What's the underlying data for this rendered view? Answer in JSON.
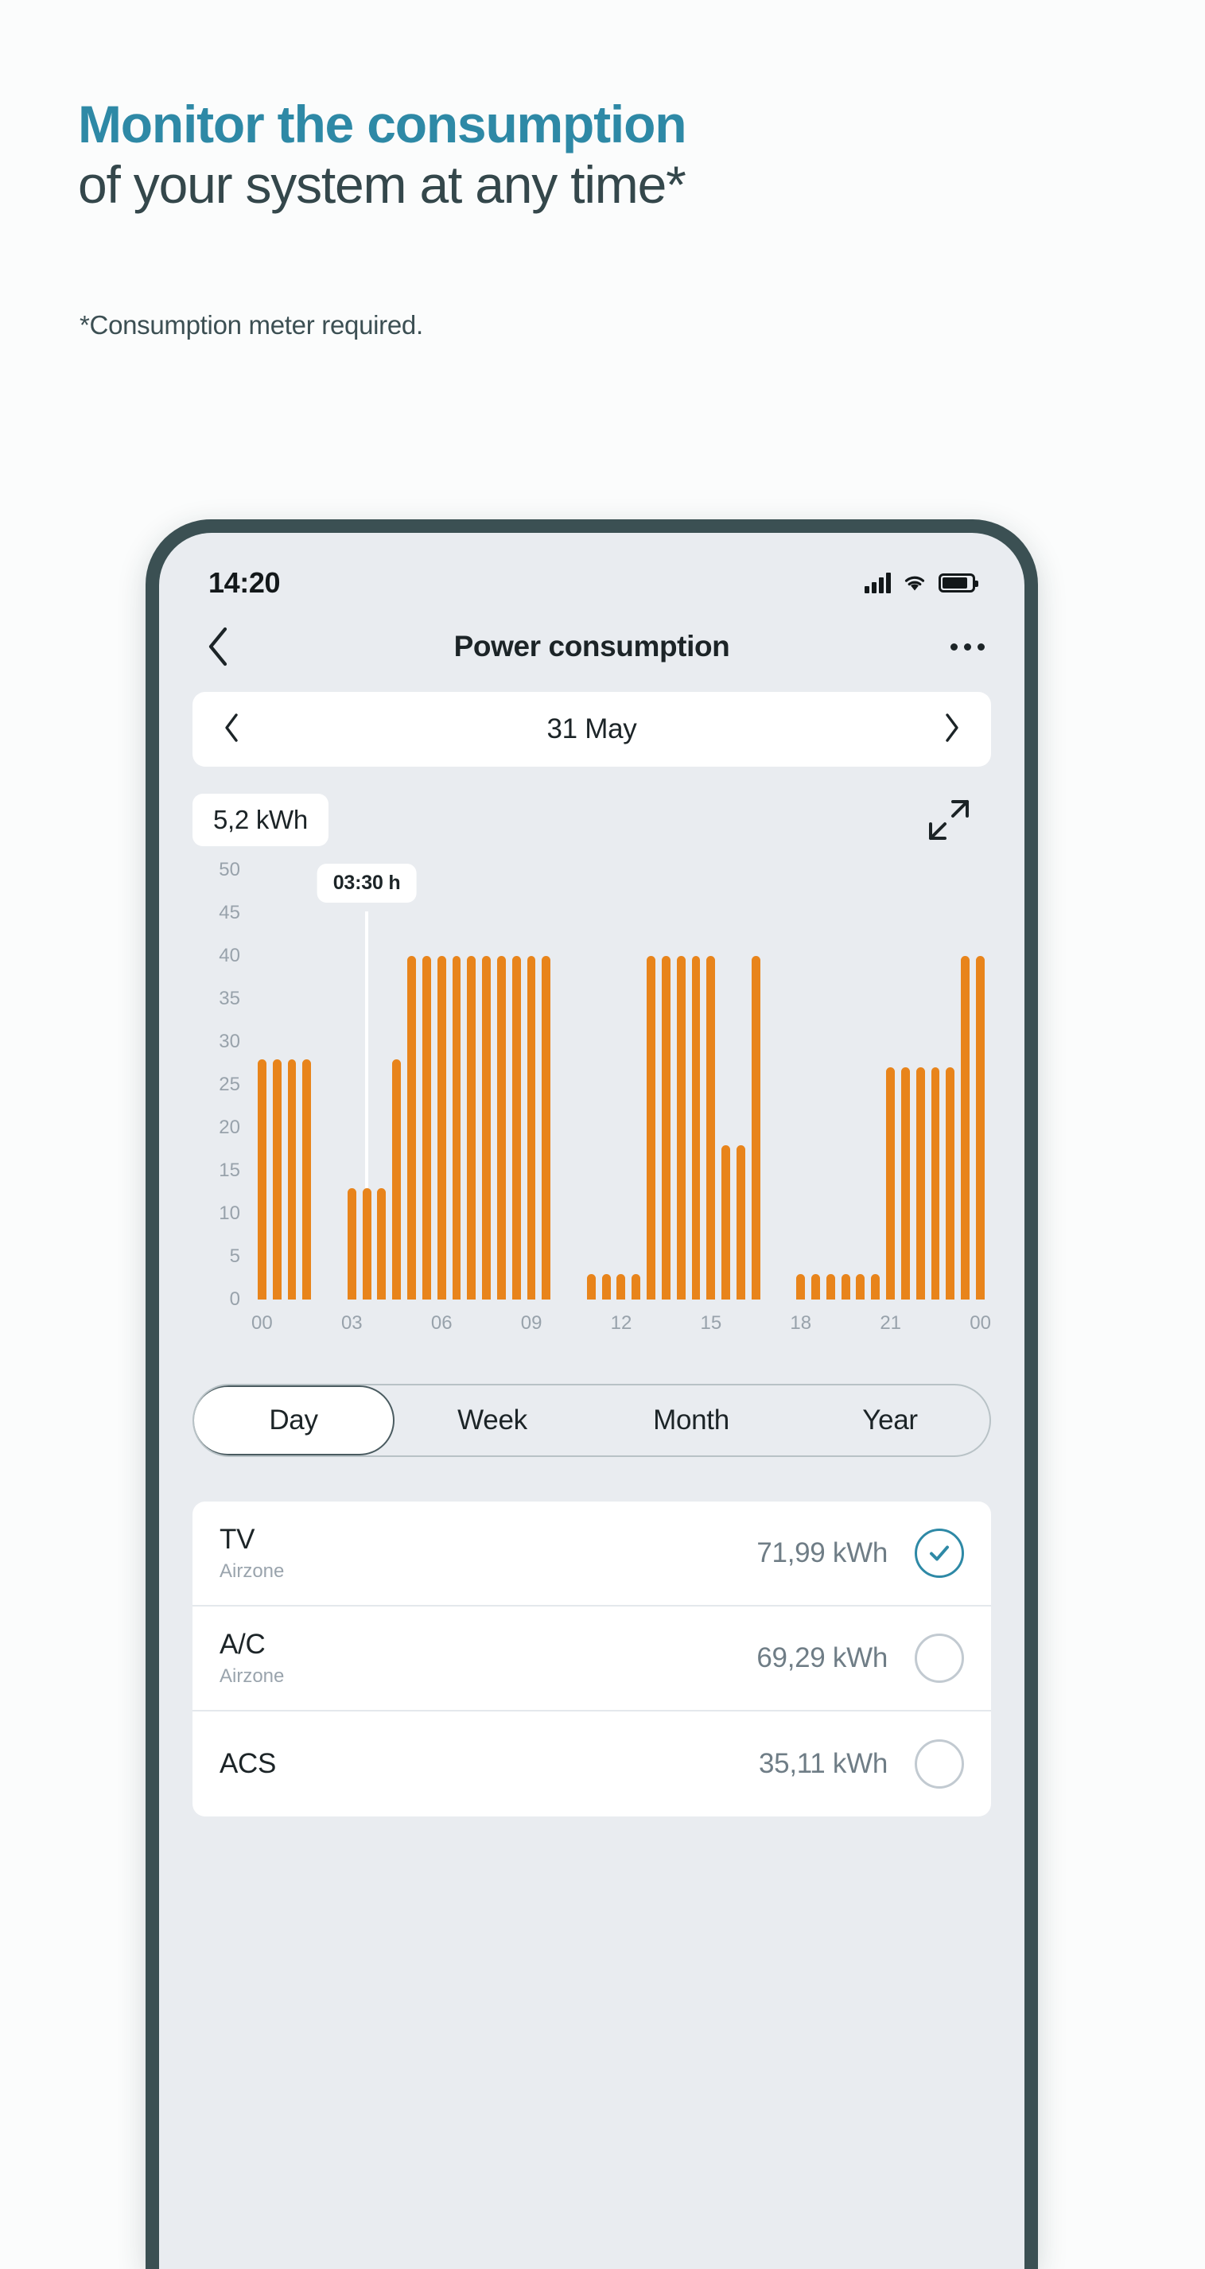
{
  "hero": {
    "headline_line1": "Monitor the consumption",
    "headline_line2": "of your system at any time*",
    "note": "*Consumption meter required.",
    "accent_color": "#2e89a6",
    "text_color": "#34474b"
  },
  "phone": {
    "status_bar": {
      "time": "14:20",
      "icons": [
        "cellular-signal-icon",
        "wifi-icon",
        "battery-icon"
      ]
    },
    "nav": {
      "back_icon": "chevron-left-icon",
      "title": "Power consumption",
      "more_icon": "more-options-icon"
    },
    "date_selector": {
      "prev_icon": "chevron-left-icon",
      "label": "31 May",
      "next_icon": "chevron-right-icon"
    },
    "chart_header": {
      "total_badge": "5,2 kWh",
      "expand_icon": "expand-fullscreen-icon"
    },
    "tabs": [
      {
        "label": "Day",
        "active": true
      },
      {
        "label": "Week",
        "active": false
      },
      {
        "label": "Month",
        "active": false
      },
      {
        "label": "Year",
        "active": false
      }
    ],
    "devices": [
      {
        "name": "TV",
        "subtitle": "Airzone",
        "value": "71,99 kWh",
        "selected": true
      },
      {
        "name": "A/C",
        "subtitle": "Airzone",
        "value": "69,29 kWh",
        "selected": false
      },
      {
        "name": "ACS",
        "subtitle": "",
        "value": "35,11 kWh",
        "selected": false
      }
    ]
  },
  "chart_data": {
    "type": "bar",
    "title": "Power consumption",
    "xlabel": "",
    "ylabel": "",
    "ylim": [
      0,
      50
    ],
    "yticks": [
      50,
      45,
      40,
      35,
      30,
      25,
      20,
      15,
      10,
      5,
      0
    ],
    "xticks": [
      "00",
      "03",
      "06",
      "09",
      "12",
      "15",
      "18",
      "21",
      "00"
    ],
    "xtick_positions": [
      0,
      6,
      12,
      18,
      24,
      30,
      36,
      42,
      48
    ],
    "grid": false,
    "legend": false,
    "bar_color": "#e8841b",
    "annotation": {
      "label": "03:30 h",
      "index": 7
    },
    "series": [
      {
        "name": "Power consumption",
        "values": [
          28,
          28,
          28,
          28,
          0,
          0,
          13,
          13,
          13,
          28,
          40,
          40,
          40,
          40,
          40,
          40,
          40,
          40,
          40,
          40,
          0,
          0,
          3,
          3,
          3,
          3,
          40,
          40,
          40,
          40,
          40,
          18,
          18,
          40,
          0,
          0,
          3,
          3,
          3,
          3,
          3,
          3,
          27,
          27,
          27,
          27,
          27,
          40,
          40
        ]
      }
    ]
  }
}
